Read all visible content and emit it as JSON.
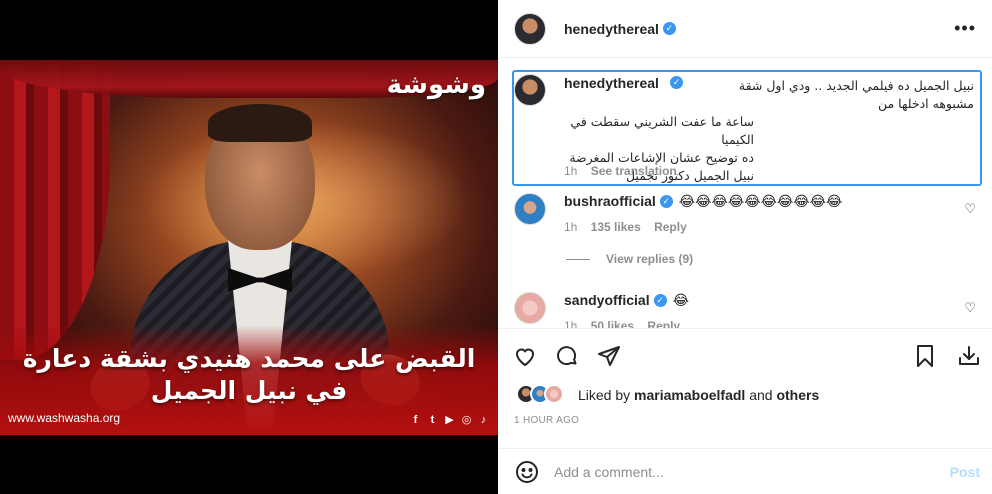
{
  "post": {
    "image": {
      "brand_logo": "وشوشة",
      "headline_line1": "القبض على محمد هنيدي بشقة دعارة",
      "headline_line2": "في نبيل الجميل",
      "site_url": "www.washwasha.org",
      "social_icons": [
        "facebook-icon",
        "twitter-icon",
        "youtube-icon",
        "instagram-icon",
        "tiktok-icon"
      ]
    }
  },
  "header": {
    "username": "henedythereal",
    "verified": true,
    "more_icon": "more-options-icon"
  },
  "caption": {
    "username": "henedythereal",
    "line1": "نبيل الجميل ده فيلمي الجديد .. ودي اول شقة مشبوهه ادخلها من",
    "line2": "ساعة ما عفت الشريني سقطت في الكيميا",
    "line3": "ده توضيح عشان الإشاعات المغرضة",
    "line4": "نبيل الجميل دكتور تجميل",
    "time": "1h",
    "see_translation": "See translation"
  },
  "comments": [
    {
      "username": "bushraofficial",
      "emoji": "😂😂😂😂😂😂😂😂😂😂",
      "time": "1h",
      "likes": "135 likes",
      "reply": "Reply",
      "view_replies": "View replies (9)"
    },
    {
      "username": "sandyofficial",
      "emoji": "😂",
      "time": "1h",
      "likes": "50 likes",
      "reply": "Reply"
    }
  ],
  "actions": {
    "icons": [
      "heart-icon",
      "comment-icon",
      "share-icon",
      "bookmark-icon",
      "download-icon"
    ],
    "liked_by_prefix": "Liked by",
    "liked_by_user": "mariamaboelfadl",
    "liked_by_suffix": "and",
    "liked_by_others": "others",
    "time_ago": "1 HOUR AGO"
  },
  "add_comment": {
    "placeholder": "Add a comment...",
    "post_label": "Post"
  },
  "colors": {
    "accent": "#3897f0",
    "post_disabled": "#b2dffc",
    "muted_text": "#8e8e8e",
    "image_band_red": "#b3100f"
  }
}
